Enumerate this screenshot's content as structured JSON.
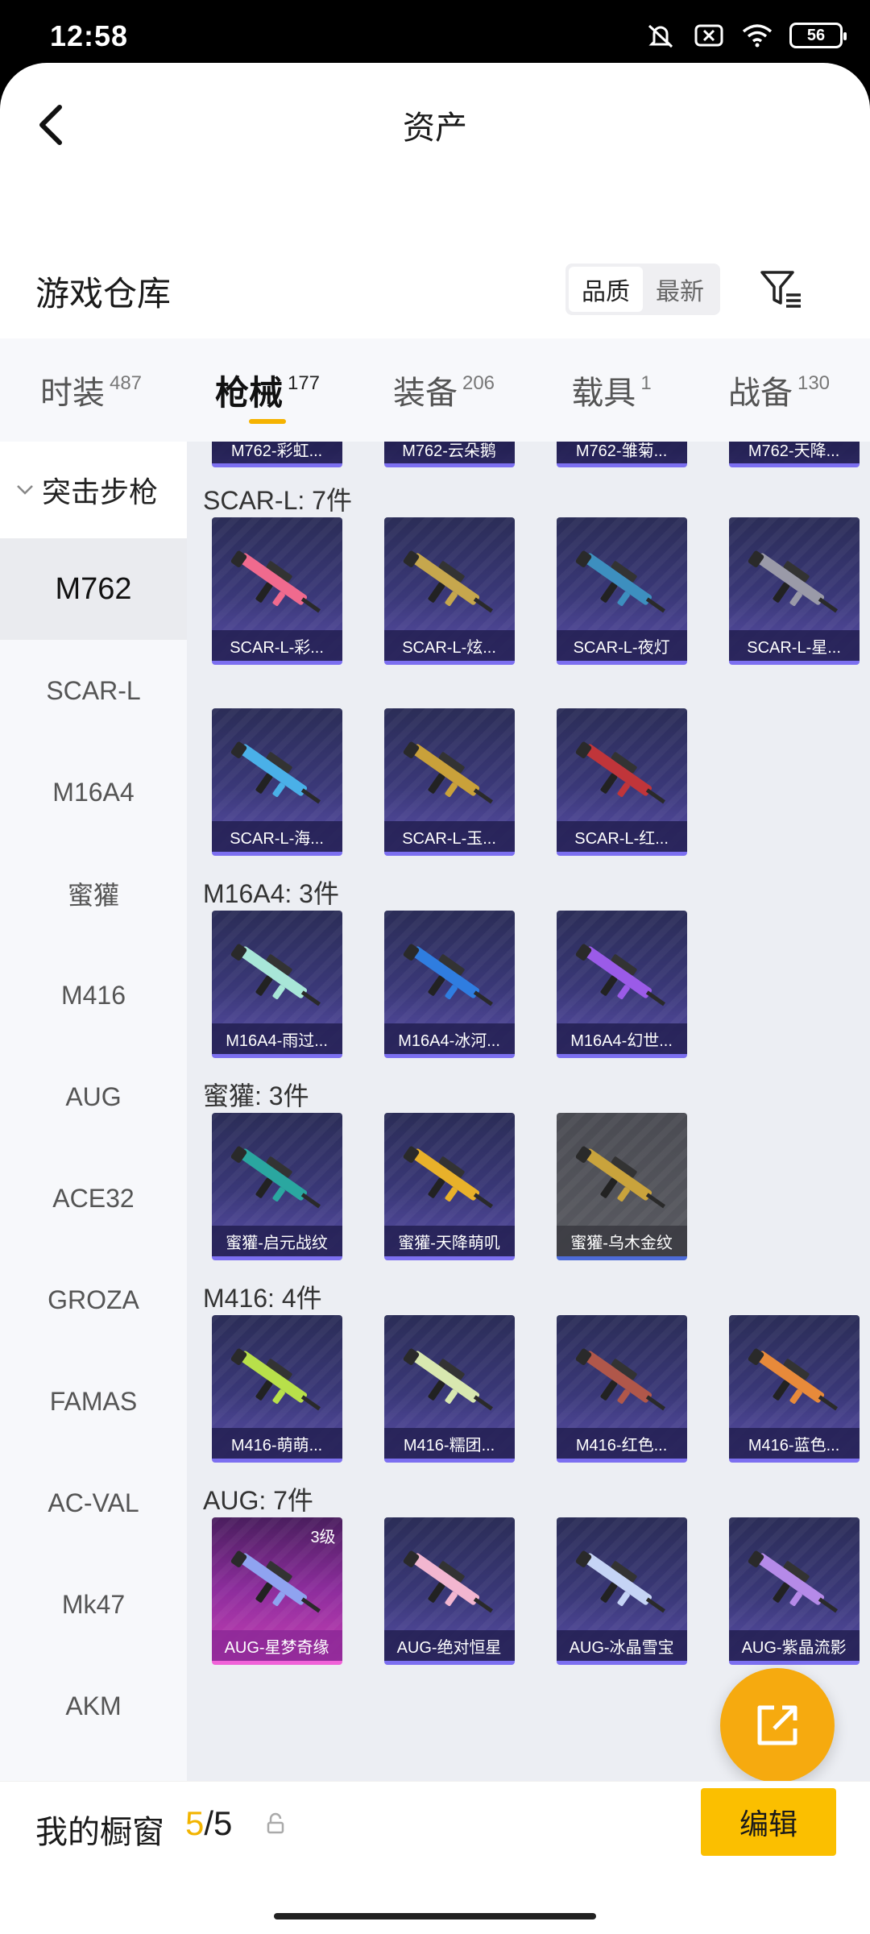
{
  "status_bar": {
    "time": "12:58",
    "battery": "56"
  },
  "header": {
    "title": "资产"
  },
  "warehouse": {
    "title": "游戏仓库",
    "sort_options": [
      "品质",
      "最新"
    ],
    "active_sort": "品质"
  },
  "tabs": [
    {
      "label": "时装",
      "count": "487",
      "active": false
    },
    {
      "label": "枪械",
      "count": "177",
      "active": true
    },
    {
      "label": "装备",
      "count": "206",
      "active": false
    },
    {
      "label": "载具",
      "count": "1",
      "active": false
    },
    {
      "label": "战备",
      "count": "130",
      "active": false
    }
  ],
  "sidebar": {
    "group": "突击步枪",
    "items": [
      "M762",
      "SCAR-L",
      "M16A4",
      "蜜獾",
      "M416",
      "AUG",
      "ACE32",
      "GROZA",
      "FAMAS",
      "AC-VAL",
      "Mk47",
      "AKM"
    ],
    "active": "M762"
  },
  "sections": [
    {
      "title": "",
      "items": [
        {
          "name": "M762-彩虹...",
          "style": "purple",
          "gun_color": "#e86fb4"
        },
        {
          "name": "M762-云朵鹅",
          "style": "purple",
          "gun_color": "#9ad6ff"
        },
        {
          "name": "M762-雏菊...",
          "style": "purple",
          "gun_color": "#f5d36b"
        },
        {
          "name": "M762-天降...",
          "style": "purple",
          "gun_color": "#c0c0c0"
        }
      ]
    },
    {
      "title": "SCAR-L: 7件",
      "items": [
        {
          "name": "SCAR-L-彩...",
          "style": "purple",
          "gun_color": "#f06a8e"
        },
        {
          "name": "SCAR-L-炫...",
          "style": "purple",
          "gun_color": "#c6a74d"
        },
        {
          "name": "SCAR-L-夜灯",
          "style": "purple",
          "gun_color": "#3d8fbf"
        },
        {
          "name": "SCAR-L-星...",
          "style": "purple",
          "gun_color": "#9a9aa8"
        },
        {
          "name": "SCAR-L-海...",
          "style": "purple",
          "gun_color": "#4ab0e8"
        },
        {
          "name": "SCAR-L-玉...",
          "style": "purple",
          "gun_color": "#c9a13a"
        },
        {
          "name": "SCAR-L-红...",
          "style": "purple",
          "gun_color": "#c0353a"
        }
      ]
    },
    {
      "title": "M16A4: 3件",
      "items": [
        {
          "name": "M16A4-雨过...",
          "style": "purple",
          "gun_color": "#a8e6d8"
        },
        {
          "name": "M16A4-冰河...",
          "style": "purple",
          "gun_color": "#2f7de0"
        },
        {
          "name": "M16A4-幻世...",
          "style": "purple",
          "gun_color": "#9b5be8"
        }
      ]
    },
    {
      "title": "蜜獾: 3件",
      "items": [
        {
          "name": "蜜獾-启元战纹",
          "style": "purple",
          "gun_color": "#2aa7a0"
        },
        {
          "name": "蜜獾-天降萌叽",
          "style": "purple",
          "gun_color": "#e8b12a"
        },
        {
          "name": "蜜獾-乌木金纹",
          "style": "gray",
          "gun_color": "#c9a33c"
        }
      ]
    },
    {
      "title": "M416: 4件",
      "items": [
        {
          "name": "M416-萌萌...",
          "style": "purple",
          "gun_color": "#b8e04a"
        },
        {
          "name": "M416-糯团...",
          "style": "purple",
          "gun_color": "#d8e8b0"
        },
        {
          "name": "M416-红色...",
          "style": "purple",
          "gun_color": "#b0574a"
        },
        {
          "name": "M416-蓝色...",
          "style": "purple",
          "gun_color": "#e88a3a"
        }
      ]
    },
    {
      "title": "AUG: 7件",
      "items": [
        {
          "name": "AUG-星梦奇缘",
          "style": "pink",
          "gun_color": "#8fa3f0",
          "level": "3级"
        },
        {
          "name": "AUG-绝对恒星",
          "style": "purple",
          "gun_color": "#f2b6d0"
        },
        {
          "name": "AUG-冰晶雪宝",
          "style": "purple",
          "gun_color": "#c5d4f5"
        },
        {
          "name": "AUG-紫晶流影",
          "style": "purple",
          "gun_color": "#b58ae8"
        }
      ]
    }
  ],
  "bottom_bar": {
    "label": "我的橱窗",
    "count_current": "5",
    "count_sep": "/5",
    "edit_label": "编辑"
  },
  "colors": {
    "accent": "#f5b301",
    "fab": "#f6aa0f"
  }
}
